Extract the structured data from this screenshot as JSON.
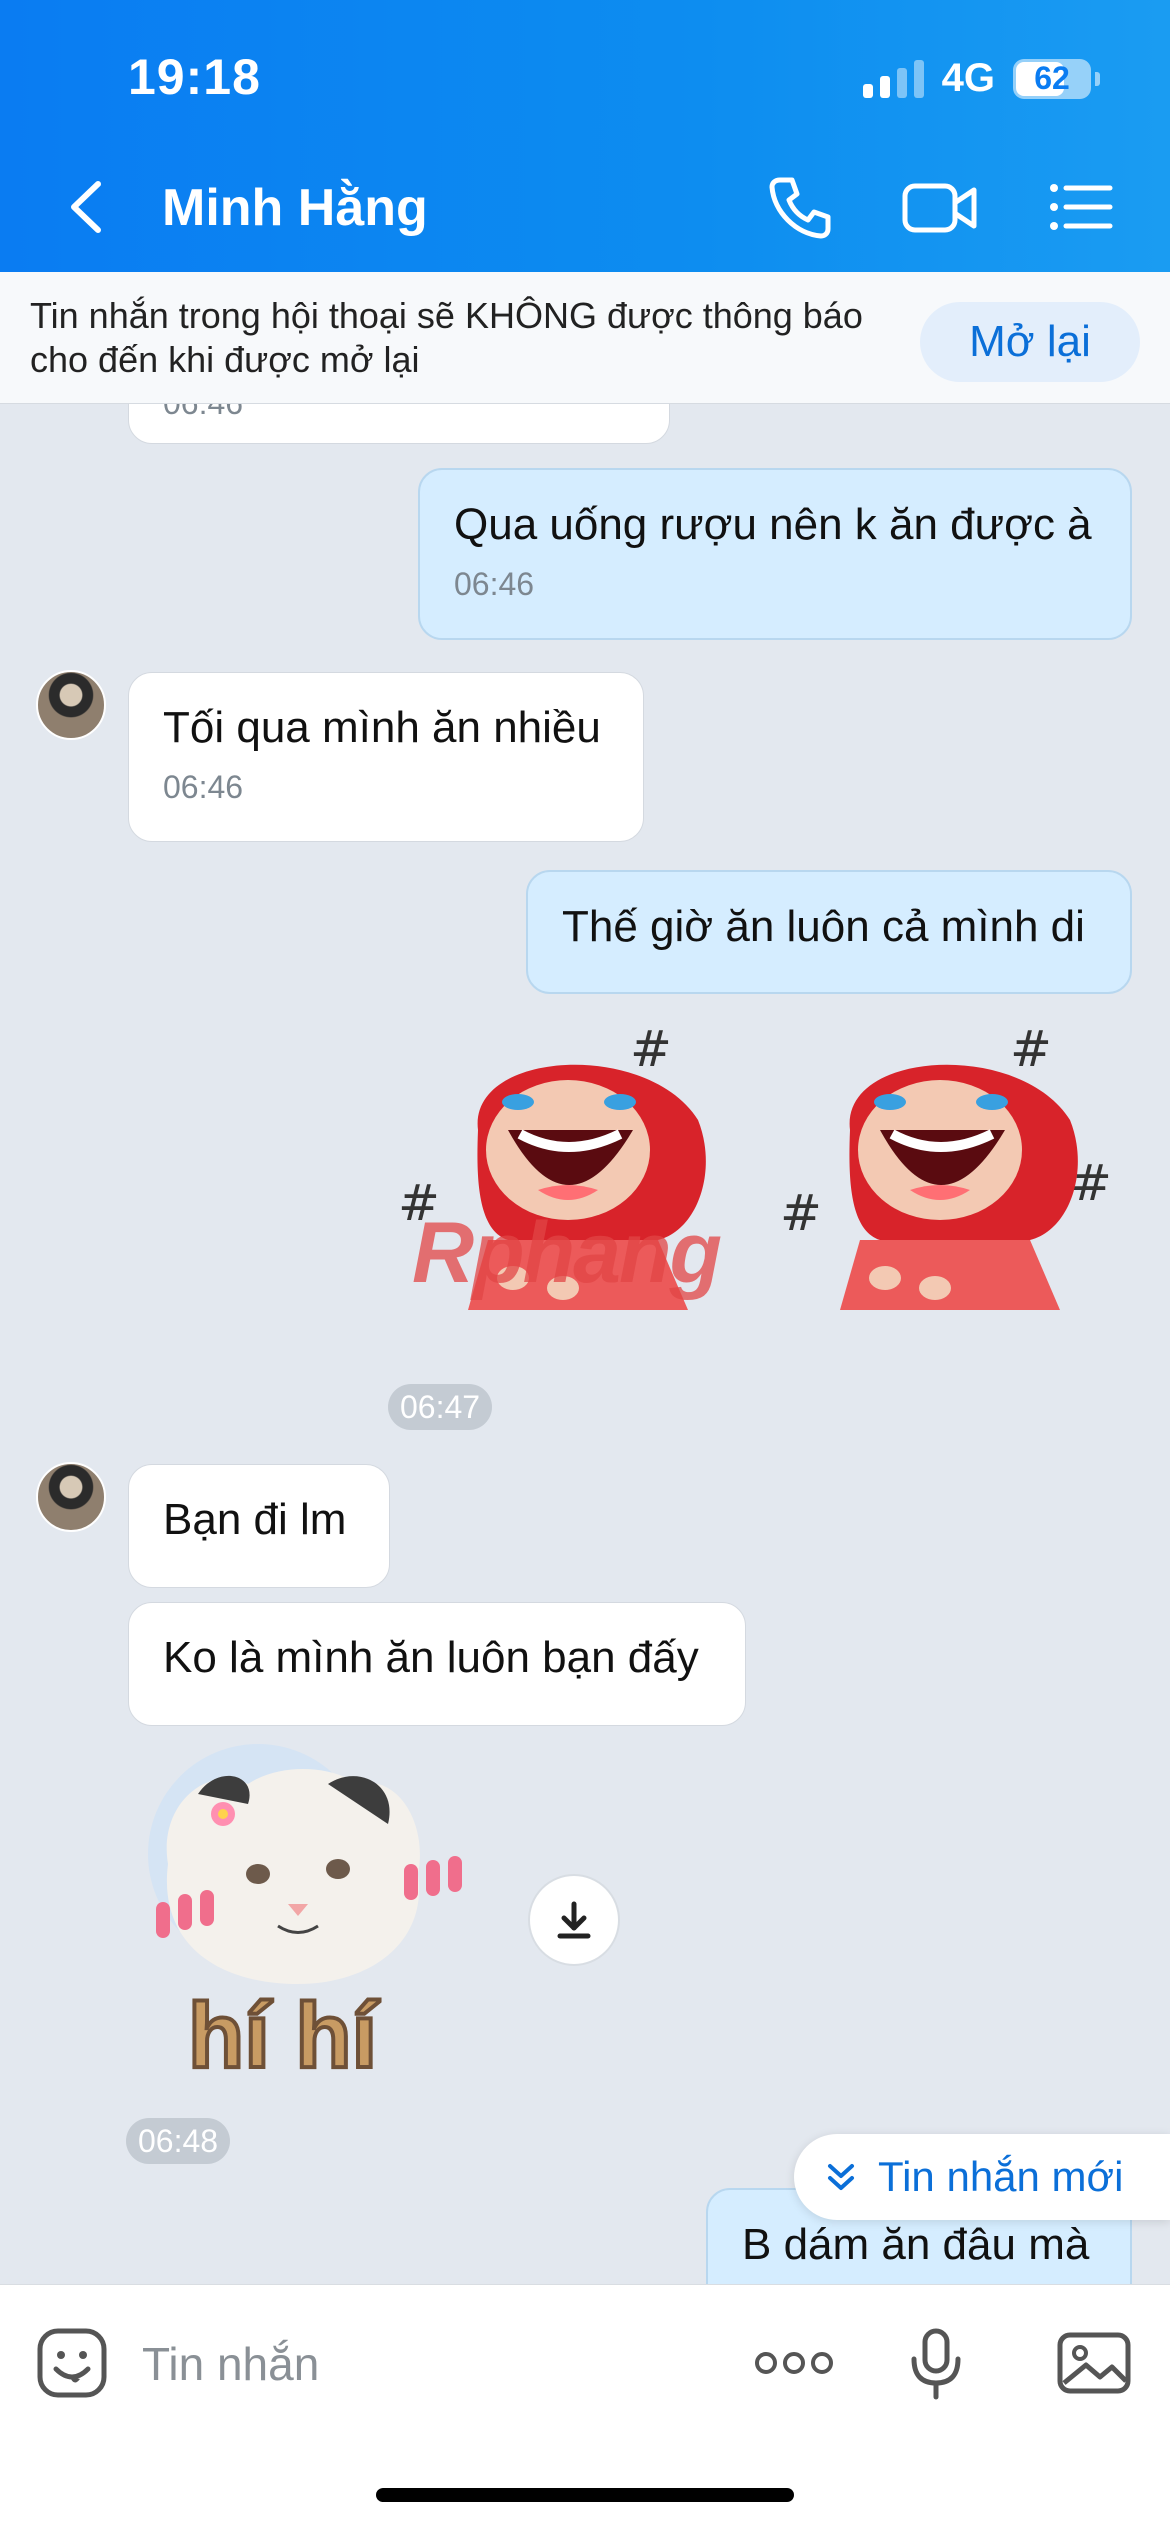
{
  "status_bar": {
    "time": "19:18",
    "network": "4G",
    "battery": "62"
  },
  "header": {
    "contact_name": "Minh Hằng"
  },
  "banner": {
    "text": "Tin nhắn trong hội thoại sẽ KHÔNG được thông báo cho đến khi được mở lại",
    "button_label": "Mở lại"
  },
  "messages": {
    "m0": {
      "time": "06:46"
    },
    "m1": {
      "text": "Qua uống rượu nên k ăn được à",
      "time": "06:46"
    },
    "m2": {
      "text": "Tối qua mình ăn nhiều",
      "time": "06:46"
    },
    "m3": {
      "text": "Thế giờ ăn luôn cả mình di"
    },
    "stickers_time": "06:47",
    "m4": {
      "text": "Bạn đi lm"
    },
    "m5": {
      "text": "Ko là mình ăn luôn bạn đấy"
    },
    "cat_sticker_text": "hí hí",
    "cat_time": "06:48",
    "m6": {
      "text": "B dám ăn đâu mà"
    }
  },
  "watermark": "Rphang",
  "new_messages_label": "Tin nhắn mới",
  "input": {
    "placeholder": "Tin nhắn"
  },
  "colors": {
    "accent": "#0a7cf2",
    "outgoing_bubble": "#d5edff",
    "incoming_bubble": "#ffffff",
    "chat_bg": "#e3e8ef"
  }
}
